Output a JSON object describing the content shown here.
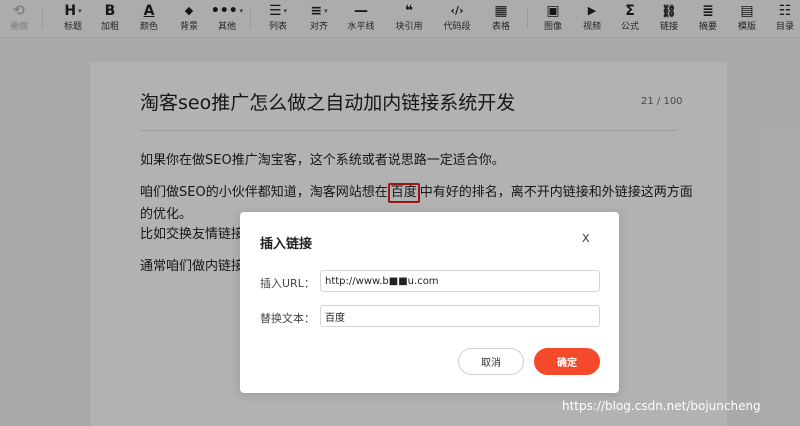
{
  "toolbar": {
    "undo": {
      "icon": "⟲",
      "label": "重做"
    },
    "heading": {
      "icon": "H",
      "label": "标题"
    },
    "bold": {
      "icon": "B",
      "label": "加粗"
    },
    "color": {
      "icon": "A",
      "label": "颜色"
    },
    "background": {
      "icon": "◆",
      "label": "背景"
    },
    "more": {
      "icon": "•••",
      "label": "其他"
    },
    "list": {
      "icon": "☰",
      "label": "列表"
    },
    "align": {
      "icon": "≡",
      "label": "对齐"
    },
    "hr": {
      "icon": "—",
      "label": "水平线"
    },
    "quote": {
      "icon": "❝",
      "label": "块引用"
    },
    "code": {
      "icon": "‹/›",
      "label": "代码段"
    },
    "table": {
      "icon": "▦",
      "label": "表格"
    },
    "image": {
      "icon": "▣",
      "label": "图像"
    },
    "video": {
      "icon": "▶",
      "label": "视频"
    },
    "formula": {
      "icon": "Σ",
      "label": "公式"
    },
    "link": {
      "icon": "⛓",
      "label": "链接"
    },
    "summary": {
      "icon": "≣",
      "label": "摘要"
    },
    "template": {
      "icon": "▤",
      "label": "模版"
    },
    "toc": {
      "icon": "☷",
      "label": "目录"
    },
    "caret": "▾"
  },
  "doc": {
    "title": "淘客seo推广怎么做之自动加内链接系统开发",
    "word_count": "21 / 100",
    "p1": "如果你在做SEO推广淘宝客，这个系统或者说思路一定适合你。",
    "p2_before": "咱们做SEO的小伙伴都知道，淘客网站想在",
    "p2_highlight": "百度",
    "p2_after": "中有好的排名，离不开内链接和外链接这两方面",
    "p2_line2": "的优化。",
    "p3": "比如交换友情链接",
    "p4": "通常咱们做内链接"
  },
  "dialog": {
    "title": "插入链接",
    "close": "X",
    "url_label": "插入URL：",
    "url_value": "http://www.b■■u.com",
    "text_label": "替换文本：",
    "text_value": "百度",
    "cancel": "取消",
    "confirm": "确定"
  },
  "watermark": "https://blog.csdn.net/bojuncheng",
  "colors": {
    "accent": "#f5492b",
    "highlight_border": "#e02020"
  }
}
